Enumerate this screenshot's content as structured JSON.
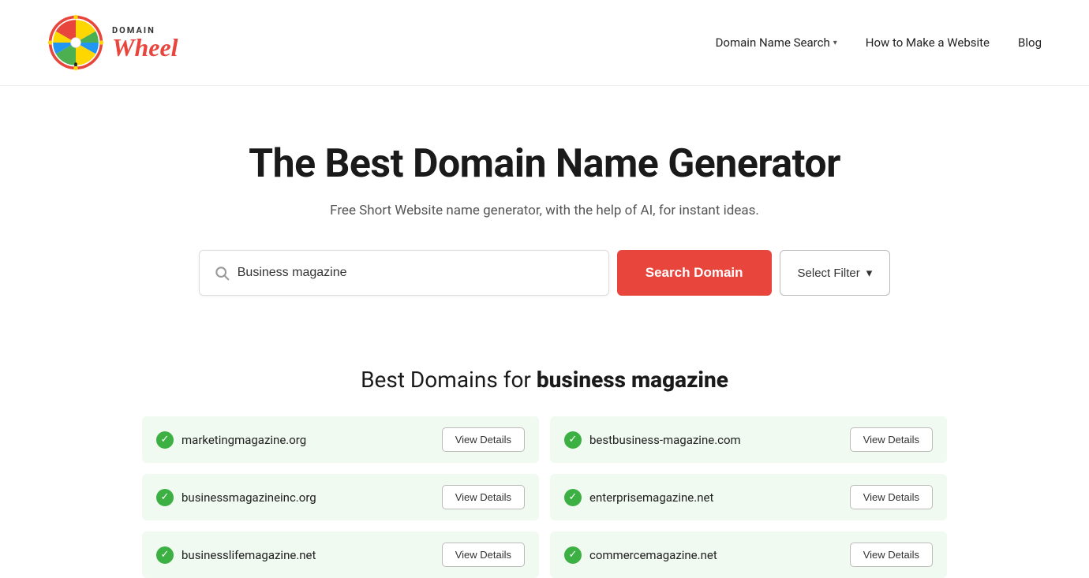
{
  "header": {
    "logo_domain": "DOMAIN",
    "logo_wheel": "Wheel",
    "nav": [
      {
        "label": "Domain Name Search",
        "has_dropdown": true
      },
      {
        "label": "How to Make a Website",
        "has_dropdown": false
      },
      {
        "label": "Blog",
        "has_dropdown": false
      }
    ]
  },
  "hero": {
    "title": "The Best Domain Name Generator",
    "subtitle": "Free Short Website name generator, with the help of AI, for instant ideas.",
    "search_placeholder": "Business magazine",
    "search_value": "Business magazine",
    "search_button": "Search Domain",
    "filter_button": "Select Filter"
  },
  "results": {
    "title_prefix": "Best Domains for ",
    "title_query": "business magazine",
    "domains": [
      {
        "name": "marketingmagazine.org",
        "available": true
      },
      {
        "name": "bestbusiness-magazine.com",
        "available": true
      },
      {
        "name": "businessmagazineinc.org",
        "available": true
      },
      {
        "name": "enterprisemagazine.net",
        "available": true
      },
      {
        "name": "businesslifemagazine.net",
        "available": true
      },
      {
        "name": "commercemagazine.net",
        "available": true
      }
    ],
    "view_details_label": "View Details"
  }
}
